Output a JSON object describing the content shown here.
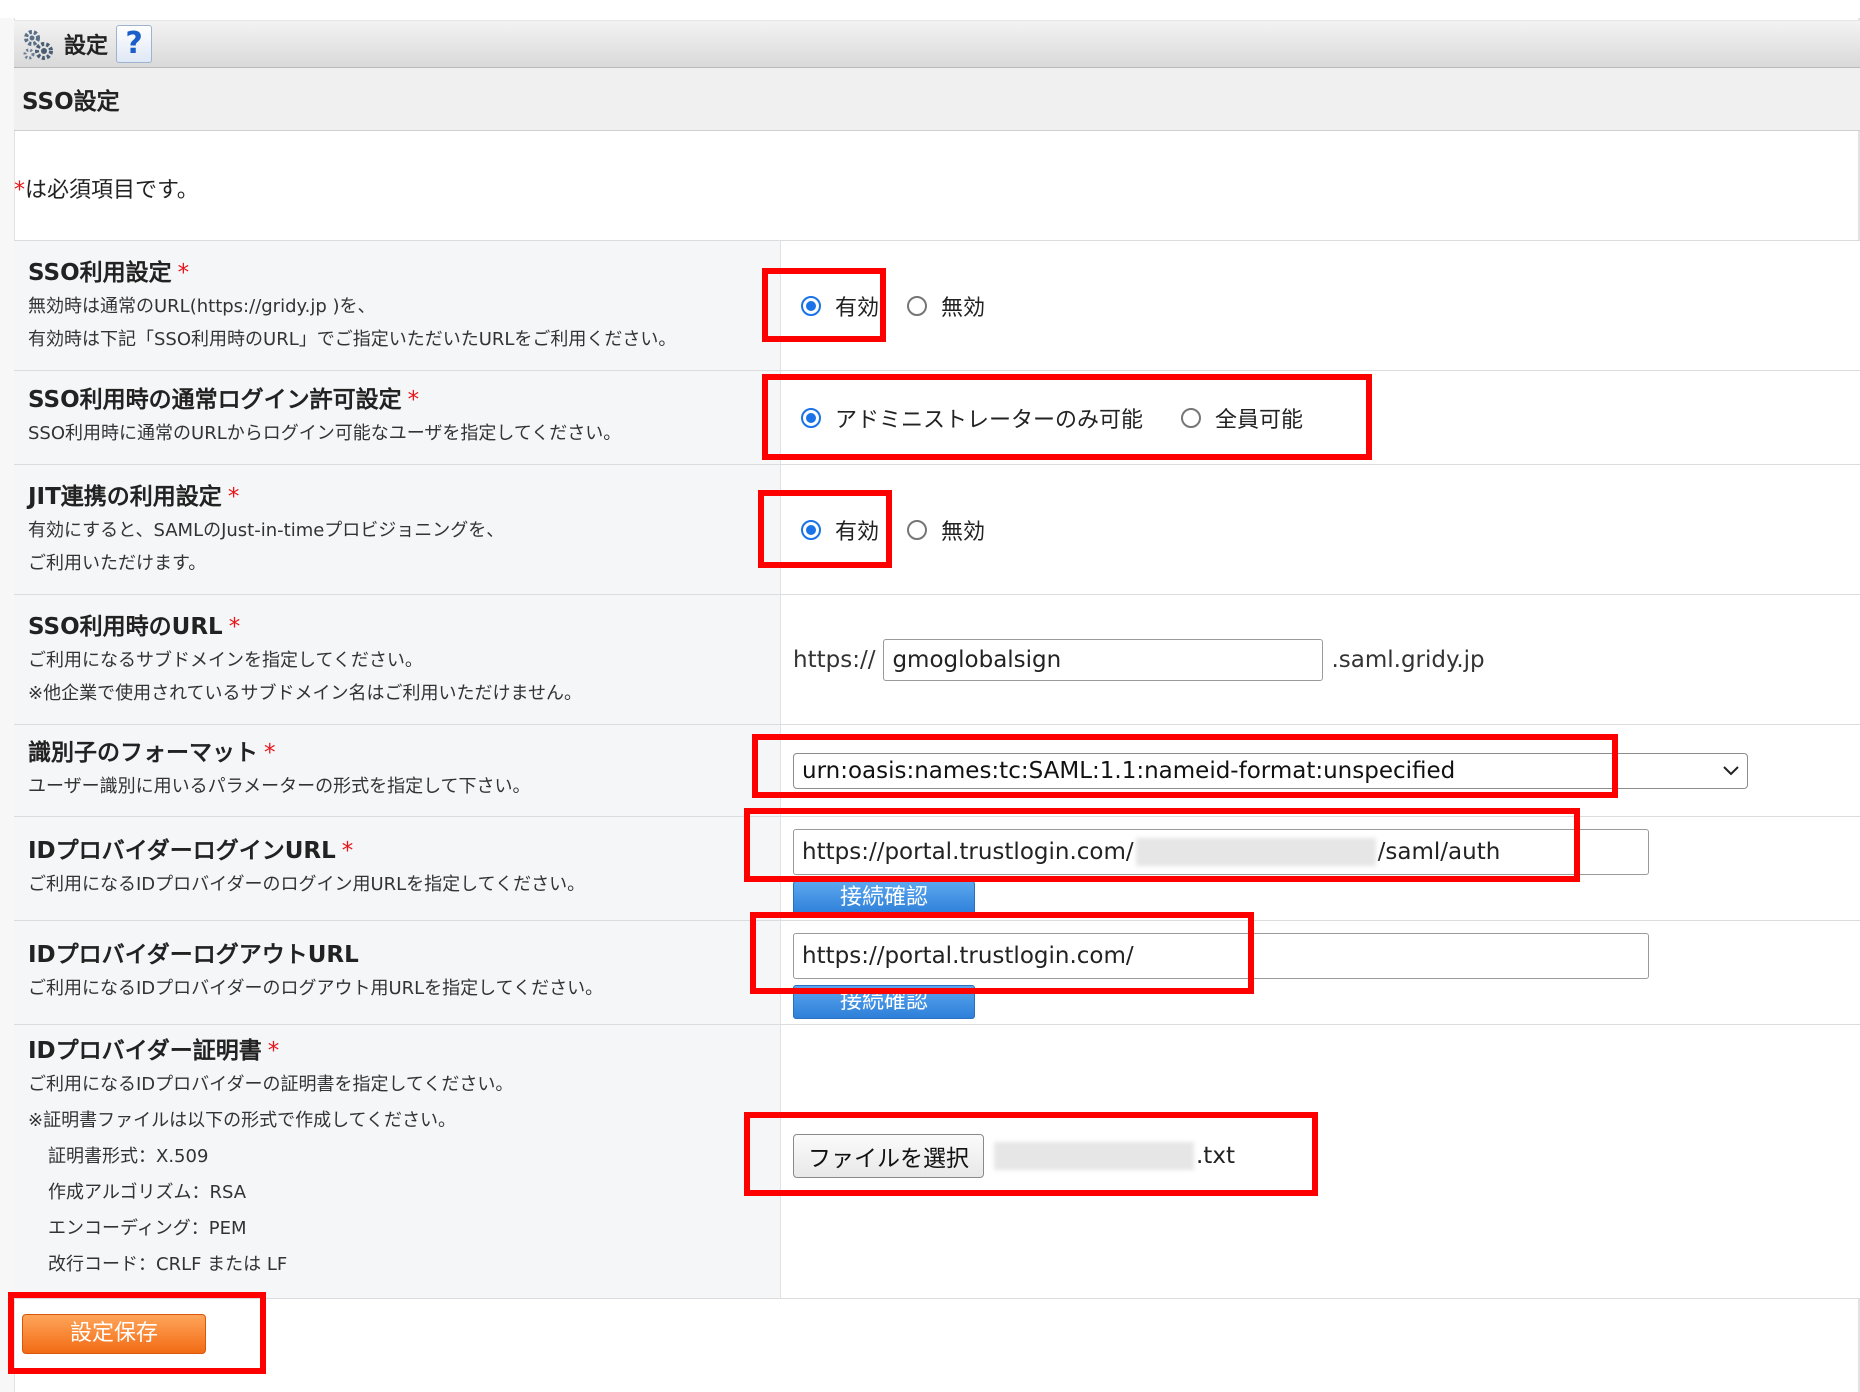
{
  "titlebar": {
    "title": "設定",
    "help_label": "?"
  },
  "subheader": {
    "title": "SSO設定"
  },
  "required_note": {
    "star": "*",
    "text": "は必須項目です。"
  },
  "rows": {
    "sso_use": {
      "label": "SSO利用設定",
      "star": "*",
      "desc1": "無効時は通常のURL(https://gridy.jp )を、",
      "desc2": "有効時は下記「SSO利用時のURL」でご指定いただいたURLをご利用ください。",
      "option1": "有効",
      "option2": "無効",
      "selected": "有効"
    },
    "normal_login": {
      "label": "SSO利用時の通常ログイン許可設定",
      "star": "*",
      "desc1": "SSO利用時に通常のURLからログイン可能なユーザを指定してください。",
      "option1": "アドミニストレーターのみ可能",
      "option2": "全員可能",
      "selected": "アドミニストレーターのみ可能"
    },
    "jit": {
      "label": "JIT連携の利用設定",
      "star": "*",
      "desc1": "有効にすると、SAMLのJust-in-timeプロビジョニングを、",
      "desc2": "ご利用いただけます。",
      "option1": "有効",
      "option2": "無効",
      "selected": "有効"
    },
    "sso_url": {
      "label": "SSO利用時のURL",
      "star": "*",
      "desc1": "ご利用になるサブドメインを指定してください。",
      "desc2": "※他企業で使用されているサブドメイン名はご利用いただけません。",
      "prefix": "https://",
      "value": "gmoglobalsign",
      "suffix": ".saml.gridy.jp"
    },
    "id_format": {
      "label": "識別子のフォーマット",
      "star": "*",
      "desc1": "ユーザー識別に用いるパラメーターの形式を指定して下さい。",
      "selected_value": "urn:oasis:names:tc:SAML:1.1:nameid-format:unspecified"
    },
    "idp_login": {
      "label": "IDプロバイダーログインURL",
      "star": "*",
      "desc1": "ご利用になるIDプロバイダーのログイン用URLを指定してください。",
      "value_prefix": "https://portal.trustlogin.com/",
      "value_suffix": "/saml/auth",
      "button": "接続確認"
    },
    "idp_logout": {
      "label": "IDプロバイダーログアウトURL",
      "desc1": "ご利用になるIDプロバイダーのログアウト用URLを指定してください。",
      "value": "https://portal.trustlogin.com/",
      "button": "接続確認"
    },
    "idp_cert": {
      "label": "IDプロバイダー証明書",
      "star": "*",
      "desc1": "ご利用になるIDプロバイダーの証明書を指定してください。",
      "desc2": "※証明書ファイルは以下の形式で作成してください。",
      "desc3": "証明書形式：X.509",
      "desc4": "作成アルゴリズム：RSA",
      "desc5": "エンコーディング：PEM",
      "desc6": "改行コード：CRLF または LF",
      "file_button": "ファイルを選択",
      "file_suffix": ".txt"
    }
  },
  "save_button": "設定保存",
  "colors": {
    "highlight": "#ff0000",
    "radio_accent": "#1a73e8",
    "required_star": "#e8161b",
    "save_button": "#f26b14",
    "check_button": "#2d7fd9"
  },
  "icons": [
    "gear-cluster-icon",
    "help-icon",
    "chevron-down-icon"
  ]
}
